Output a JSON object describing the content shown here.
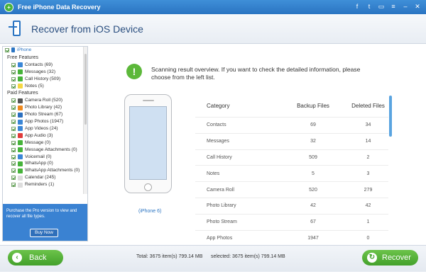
{
  "app": {
    "title": "Free iPhone Data Recovery"
  },
  "titlebar_icons": [
    "facebook-icon",
    "twitter-icon",
    "chat-icon",
    "menu-icon",
    "minimize-icon",
    "close-icon"
  ],
  "header": {
    "title": "Recover from iOS Device"
  },
  "sidebar": {
    "root": "iPhone",
    "free_title": "Free Features",
    "free": [
      {
        "label": "Contacts (69)",
        "color": "#3a86d6"
      },
      {
        "label": "Messages (32)",
        "color": "#46b33a"
      },
      {
        "label": "Call History (509)",
        "color": "#46b33a"
      },
      {
        "label": "Notes (5)",
        "color": "#f5d742"
      }
    ],
    "paid_title": "Paid Features",
    "paid": [
      {
        "label": "Camera Roll (520)",
        "color": "#555555"
      },
      {
        "label": "Photo Library (42)",
        "color": "#f08a1e"
      },
      {
        "label": "Photo Stream (67)",
        "color": "#2b6fbf"
      },
      {
        "label": "App Photos (1947)",
        "color": "#3a86d6"
      },
      {
        "label": "App Videos (24)",
        "color": "#3a86d6"
      },
      {
        "label": "App Audio (3)",
        "color": "#e03b3b"
      },
      {
        "label": "Message (0)",
        "color": "#46b33a"
      },
      {
        "label": "Message Attachments (0)",
        "color": "#46b33a"
      },
      {
        "label": "Voicemail (0)",
        "color": "#3a86d6"
      },
      {
        "label": "WhatsApp (0)",
        "color": "#46b33a"
      },
      {
        "label": "WhatsApp Attachments (0)",
        "color": "#46b33a"
      },
      {
        "label": "Calendar (245)",
        "color": "#dddddd"
      },
      {
        "label": "Reminders (1)",
        "color": "#dddddd"
      }
    ],
    "promo_text": "Purchase the Pro version to view and recover all file types.",
    "buy_label": "Buy Now"
  },
  "main": {
    "info_text": "Scanning result overview. If you want to check the detailed information, please choose from the left list.",
    "device_label": "(iPhone 6)",
    "table": {
      "headers": [
        "Category",
        "Backup Files",
        "Deleted Files"
      ],
      "rows": [
        [
          "Contacts",
          "69",
          "34"
        ],
        [
          "Messages",
          "32",
          "14"
        ],
        [
          "Call History",
          "509",
          "2"
        ],
        [
          "Notes",
          "5",
          "3"
        ],
        [
          "Camera Roll",
          "520",
          "279"
        ],
        [
          "Photo Library",
          "42",
          "42"
        ],
        [
          "Photo Stream",
          "67",
          "1"
        ],
        [
          "App Photos",
          "1947",
          "0"
        ]
      ]
    }
  },
  "footer": {
    "back_label": "Back",
    "total_text": "Total: 3675 item(s) 799.14 MB",
    "selected_text": "selected: 3675 item(s) 799.14 MB",
    "recover_label": "Recover"
  }
}
